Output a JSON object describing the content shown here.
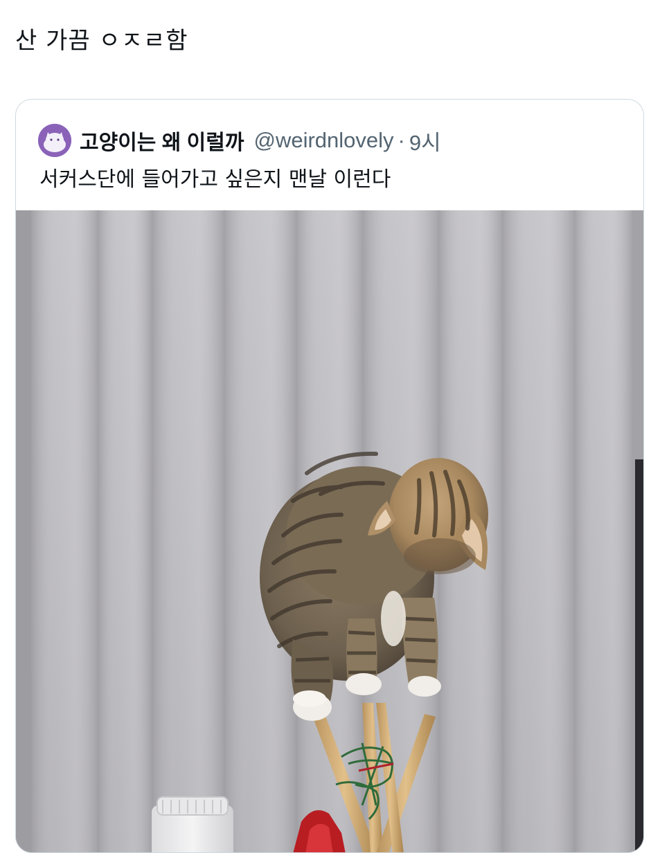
{
  "post": {
    "text": "산 가끔 ㅇㅈㄹ함"
  },
  "quote": {
    "display_name": "고양이는 왜 이럴까",
    "handle": "@weirdnlovely",
    "separator": "·",
    "time": "9시",
    "text": "서커스단에 들어가고 싶은지 맨날 이런다",
    "avatar_icon": "purple-cat-avatar-icon",
    "media_icon": "cat-balancing-on-sticks-photo"
  },
  "colors": {
    "text_primary": "#0f1419",
    "text_secondary": "#536471",
    "card_border": "#cfd9de",
    "avatar_bg": "#8a63b8"
  }
}
